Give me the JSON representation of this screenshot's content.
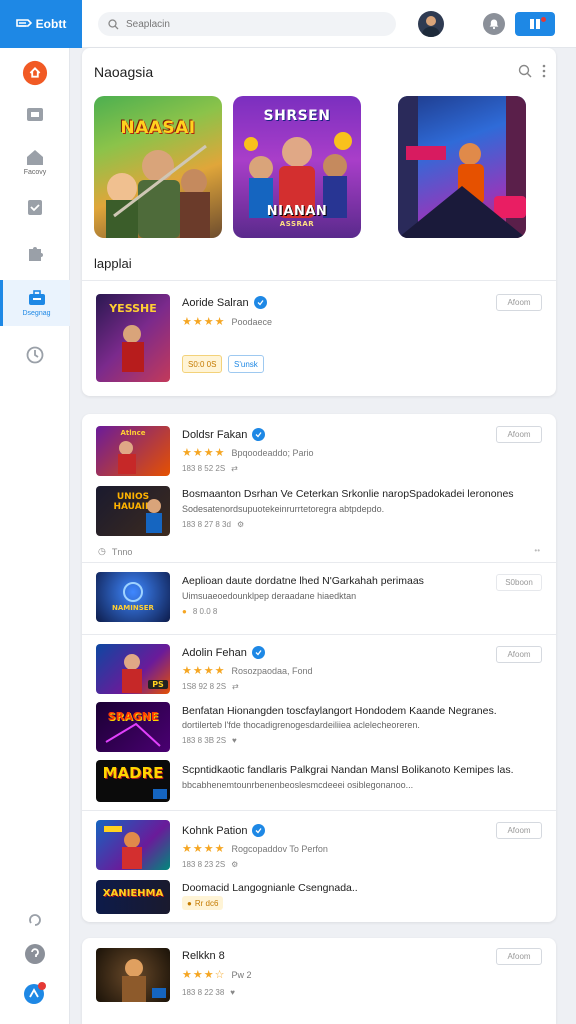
{
  "header": {
    "logo_text": "Eobtt",
    "search_placeholder": "Seaplacin"
  },
  "sidebar": {
    "items": [
      {
        "label": ""
      },
      {
        "label": ""
      },
      {
        "label": "Facovy"
      },
      {
        "label": ""
      },
      {
        "label": ""
      },
      {
        "label": "Dsegnag"
      },
      {
        "label": ""
      }
    ]
  },
  "featured": {
    "title": "Naoagsia",
    "items": [
      {
        "title": "NAASAI"
      },
      {
        "title": "SHRSEN",
        "subtitle": "NIANAN",
        "caption": "ASSRAR"
      },
      {
        "title": ""
      }
    ]
  },
  "latest": {
    "title": "lapplai",
    "app": {
      "thumb_text": "YESSHE",
      "name": "Aoride Salran",
      "rating_label": "Poodaece",
      "chip_price": "S0:0 0S",
      "chip_tag": "S'unsk",
      "button": "Afoom"
    }
  },
  "list": {
    "group1": {
      "app1": {
        "name": "Doldsr Fakan",
        "thumb_text": "Atlnce",
        "meta": "183 8 52 2S",
        "rating_label": "Bpqoodeaddo; Pario",
        "button": "Afoom"
      },
      "app2": {
        "thumb_text": "UNIOS HAUAIN",
        "desc": "Bosmaanton Dsrhan Ve Ceterkan Srkonlie naropSpadokadei leronones",
        "desc2": "Sodesatenordsupuotekeinrurrtetoregra abtpdepdo.",
        "meta": "183 8 27 8 3d"
      },
      "collapse_label": "Tnno",
      "app3": {
        "thumb_text": "NAMINSER",
        "desc": "Aeplioan daute dordatne lhed N'Garkahah perimaas",
        "desc2": "Uimsuaeoedounklpep deraadane hiaedktan",
        "meta": "8 0.0 8",
        "button": "S0boon"
      }
    },
    "group2": {
      "app1": {
        "name": "Adolin Fehan",
        "thumb_text": "PS",
        "meta": "1S8 92 8 2S",
        "rating_label": "Rosozpaodaa, Fond",
        "button": "Afoom"
      },
      "app2": {
        "thumb_text": "SRAGNE",
        "desc": "Benfatan Hionangden toscfaylangort Hondodem Kaande Negranes.",
        "desc2": "dortilerteb l'fde thocadigrenogesdardeiliiea aclelecheoreren.",
        "meta": "183 8 3B 2S"
      },
      "app3": {
        "thumb_text": "MADRE",
        "desc": "Scpntidkaotic fandlaris Palkgrai Nandan Mansl Bolikanoto Kemipes las.",
        "desc2": "bbcabhenemtounrbenenbeoslesmcdeeei osiblegonanoo...",
        "meta": "",
        "button": ""
      }
    },
    "group3": {
      "app1": {
        "name": "Kohnk Pation",
        "thumb_text": "",
        "meta": "183 8 23 2S",
        "rating_label": "Rogcopaddov To Perfon",
        "button": "Afoom"
      },
      "app2": {
        "thumb_text": "XANIEHMA",
        "desc": "Doomacid Langognianle Csengnada..",
        "chip": "Rr dc6"
      }
    }
  },
  "footer_card": {
    "name": "Relkkn 8",
    "thumb_text": "",
    "rating_suffix": "Pw 2",
    "meta": "183 8 22 38",
    "button": "Afoom"
  }
}
